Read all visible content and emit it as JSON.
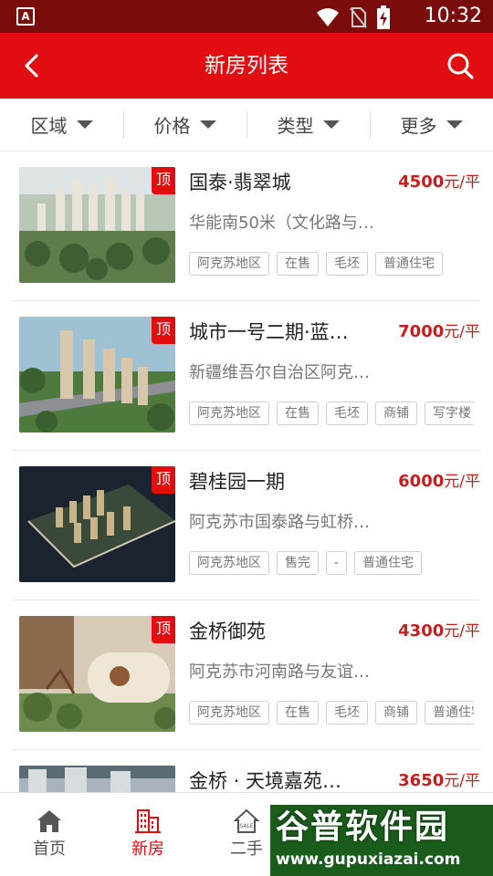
{
  "status_bar": {
    "time": "10:32",
    "left_icon": "A"
  },
  "app_bar": {
    "title": "新房列表",
    "back_icon": "back-arrow-icon",
    "search_icon": "search-icon"
  },
  "filters": [
    {
      "label": "区域"
    },
    {
      "label": "价格"
    },
    {
      "label": "类型"
    },
    {
      "label": "更多"
    }
  ],
  "listings": [
    {
      "name": "国泰·翡翠城",
      "price": "4500",
      "unit": "元/平",
      "address": "华能南50米（文化路与…",
      "badge": "顶",
      "tags": [
        "阿克苏地区",
        "在售",
        "毛坯",
        "普通住宅"
      ]
    },
    {
      "name": "城市一号二期·蓝…",
      "price": "7000",
      "unit": "元/平",
      "address": "新疆维吾尔自治区阿克…",
      "badge": "顶",
      "tags": [
        "阿克苏地区",
        "在售",
        "毛坯",
        "商铺",
        "写字楼"
      ]
    },
    {
      "name": "碧桂园一期",
      "price": "6000",
      "unit": "元/平",
      "address": "阿克苏市国泰路与虹桥…",
      "badge": "顶",
      "tags": [
        "阿克苏地区",
        "售完",
        "-",
        "普通住宅"
      ]
    },
    {
      "name": "金桥御苑",
      "price": "4300",
      "unit": "元/平",
      "address": "阿克苏市河南路与友谊…",
      "badge": "顶",
      "tags": [
        "阿克苏地区",
        "在售",
        "毛坯",
        "商铺",
        "普通住宅"
      ]
    },
    {
      "name": "金桥 · 天境嘉苑…",
      "price": "3650",
      "unit": "元/平",
      "address": "",
      "badge": "",
      "tags": []
    }
  ],
  "tab_bar": [
    {
      "label": "首页",
      "icon": "home-icon",
      "active": false
    },
    {
      "label": "新房",
      "icon": "building-icon",
      "active": true
    },
    {
      "label": "二手",
      "icon": "house-sale-icon",
      "active": false
    }
  ],
  "watermark": {
    "title": "谷普软件园",
    "url": "www.gupuxiazai.com"
  },
  "colors": {
    "brand_red": "#e10d10",
    "price_red": "#c91d1d",
    "status_bar": "#7a0c0c"
  }
}
